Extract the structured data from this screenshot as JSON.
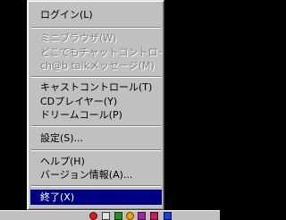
{
  "menu": {
    "items": [
      {
        "label": "ログイン(L)"
      },
      {
        "label": "ミニブラウザ(W)"
      },
      {
        "label": "どこでもチャットコントロール(B)"
      },
      {
        "label": "ch@b talkメッセージ(M)"
      },
      {
        "label": "キャストコントロール(T)"
      },
      {
        "label": "CDプレイヤー(Y)"
      },
      {
        "label": "ドリームコール(P)"
      },
      {
        "label": "設定(S)..."
      },
      {
        "label": "ヘルプ(H)"
      },
      {
        "label": "バージョン情報(A)..."
      },
      {
        "label": "終了(X)"
      }
    ]
  },
  "tray": {
    "icons": [
      "red-app-icon",
      "window-app-icon",
      "green-app-icon",
      "yellow-app-icon",
      "purple-app-icon",
      "pink-app-icon",
      "blue-app-icon"
    ]
  },
  "colors": {
    "menu_bg": "#c0c0c0",
    "highlight": "#000080",
    "disabled_text": "#808080",
    "desktop": "#000000"
  }
}
